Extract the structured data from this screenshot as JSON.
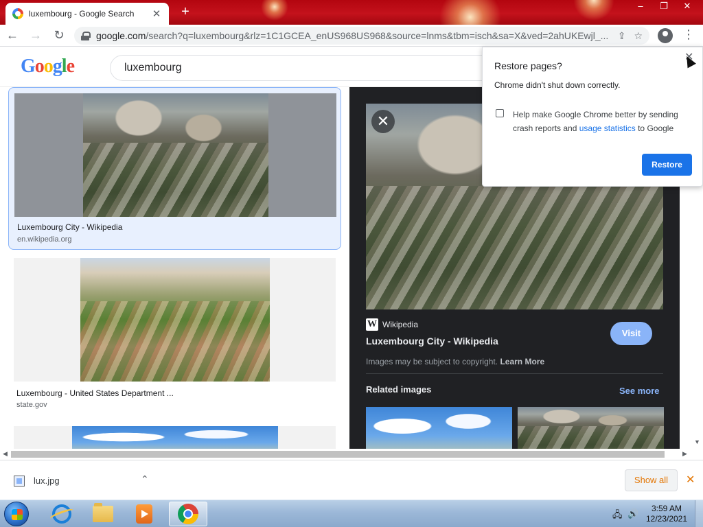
{
  "browser": {
    "tab_title": "luxembourg - Google Search",
    "tab_close_glyph": "✕",
    "new_tab_glyph": "+",
    "url_host": "google.com",
    "url_rest": "/search?q=luxembourg&rlz=1C1GCEA_enUS968US968&source=lnms&tbm=isch&sa=X&ved=2ahUKEwjl_..."
  },
  "google": {
    "search_query": "luxembourg"
  },
  "results": [
    {
      "title": "Luxembourg City - Wikipedia",
      "source": "en.wikipedia.org"
    },
    {
      "title": "Luxembourg - United States Department ...",
      "source": "state.gov"
    }
  ],
  "preview": {
    "site_name": "Wikipedia",
    "site_icon_letter": "W",
    "title": "Luxembourg City - Wikipedia",
    "visit_label": "Visit",
    "copyright_text": "Images may be subject to copyright.",
    "learn_more": "Learn More",
    "related_title": "Related images",
    "see_more": "See more"
  },
  "popup": {
    "title": "Restore pages?",
    "message": "Chrome didn't shut down correctly.",
    "checkbox_text_before": "Help make Google Chrome better by sending crash reports and ",
    "checkbox_link": "usage statistics",
    "checkbox_text_after": " to Google",
    "restore_label": "Restore",
    "checked": false
  },
  "downloads": {
    "file_name": "lux.jpg",
    "show_all_label": "Show all"
  },
  "taskbar": {
    "time": "3:59 AM",
    "date": "12/23/2021"
  },
  "colors": {
    "accent": "#1a73e8",
    "tab_strip": "#b3050f",
    "download_accent": "#e37400",
    "preview_bg": "#202124"
  }
}
